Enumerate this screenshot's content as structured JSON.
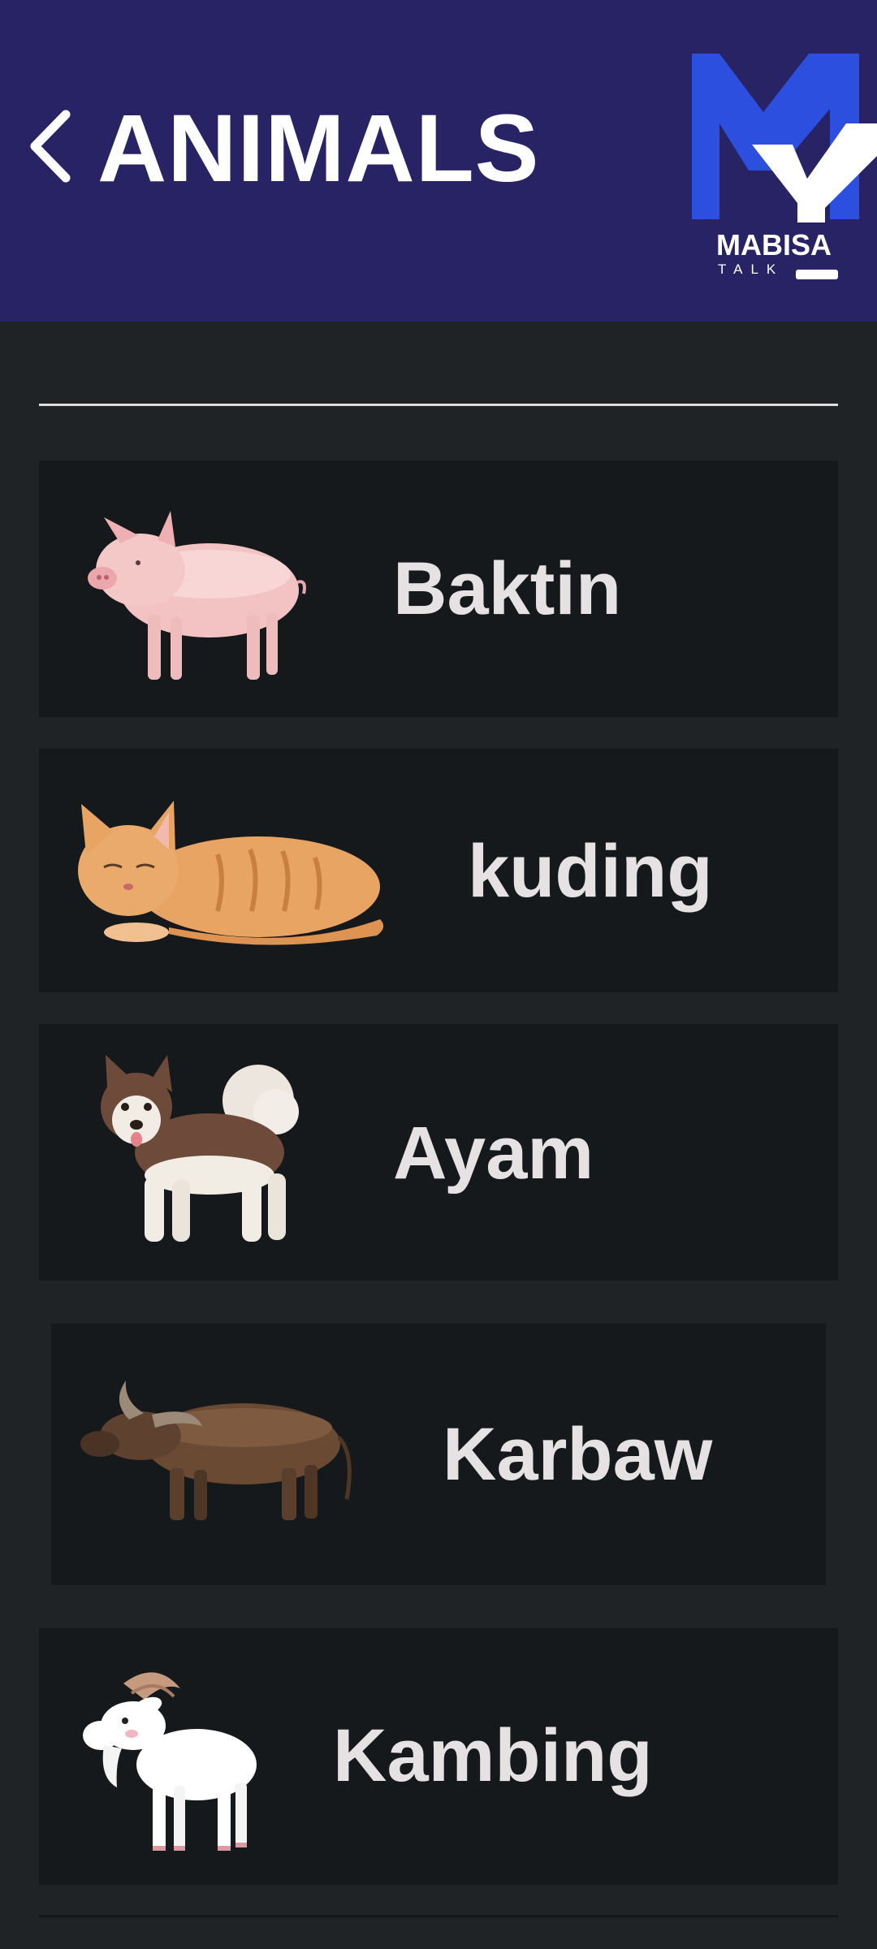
{
  "header": {
    "title": "ANIMALS",
    "back_icon": "chevron-left-icon",
    "logo": {
      "text": "MABISA",
      "subtext": "TALK"
    }
  },
  "animals": [
    {
      "label": "Baktin",
      "icon": "pig"
    },
    {
      "label": "kuding",
      "icon": "cat"
    },
    {
      "label": "Ayam",
      "icon": "dog"
    },
    {
      "label": "Karbaw",
      "icon": "water-buffalo"
    },
    {
      "label": "Kambing",
      "icon": "goat"
    }
  ],
  "colors": {
    "header_bg": "#282365",
    "page_bg": "#1f2326",
    "card_bg": "#16191b",
    "logo_blue": "#2d4fe0",
    "label_text": "#e6e2e3"
  }
}
